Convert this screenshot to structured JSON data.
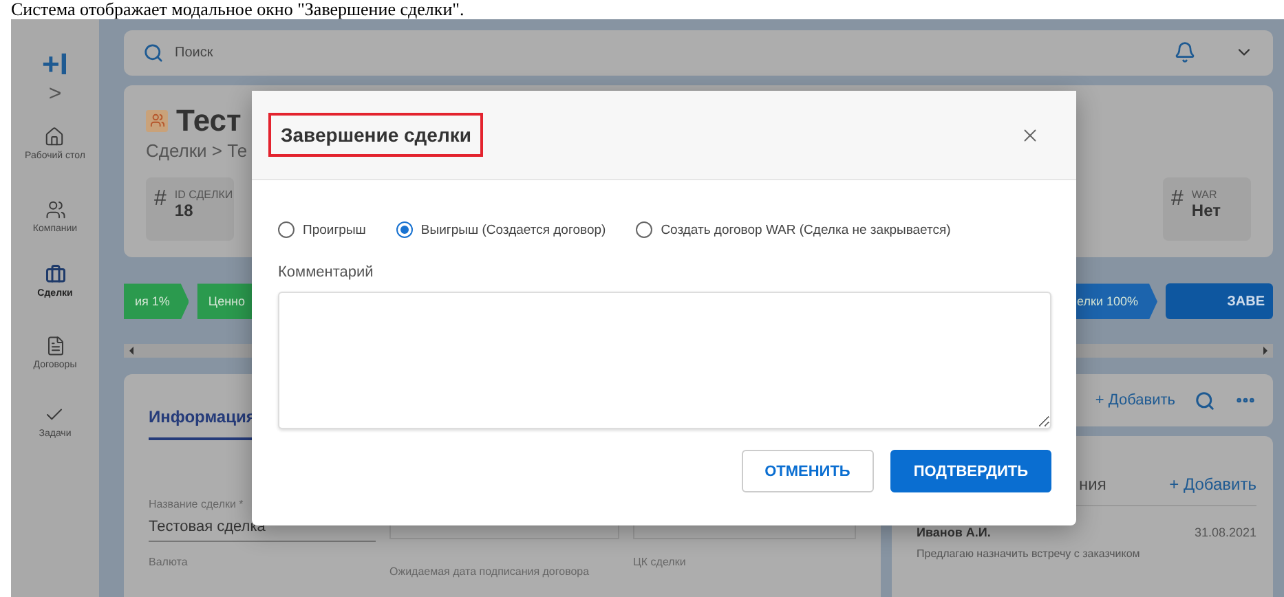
{
  "caption": "Система отображает модальное окно \"Завершение сделки\".",
  "sidebar": {
    "logo": "+I",
    "expand": ">",
    "items": [
      {
        "kind": "home",
        "label": "Рабочий стол",
        "selected": false
      },
      {
        "kind": "people",
        "label": "Компании",
        "selected": false
      },
      {
        "kind": "briefcase",
        "label": "Сделки",
        "selected": true
      },
      {
        "kind": "document",
        "label": "Договоры",
        "selected": false
      },
      {
        "kind": "check",
        "label": "Задачи",
        "selected": false
      }
    ]
  },
  "topbar": {
    "search_placeholder": "Поиск"
  },
  "deal": {
    "title": "Тест",
    "breadcrumb": "Сделки > Те",
    "stats": [
      {
        "icon": "#",
        "label": "ID СДЕЛКИ",
        "value": "18"
      },
      {
        "icon": "#",
        "label": "WAR",
        "value": "Нет"
      }
    ]
  },
  "stages": {
    "left": [
      {
        "label": "ия 1%",
        "kind": "done"
      },
      {
        "label": "Ценно",
        "kind": "done"
      }
    ],
    "right": [
      {
        "label": "елки 100%",
        "kind": "current"
      }
    ],
    "finish_button": "ЗАВЕ"
  },
  "info_panel": {
    "tab": "Информация",
    "name_label": "Название сделки *",
    "name_value": "Тестовая сделка",
    "currency_label": "Валюта",
    "date_label": "Ожидаемая дата подписания договора",
    "ck_label": "ЦК сделки"
  },
  "actions": {
    "add": "+ Добавить"
  },
  "comments": {
    "heading": "ния",
    "add": "+ Добавить",
    "items": [
      {
        "author": "Иванов А.И.",
        "date": "31.08.2021",
        "text": "Предлагаю назначить встречу с заказчиком"
      }
    ]
  },
  "modal": {
    "title": "Завершение сделки",
    "options": [
      {
        "label": "Проигрыш",
        "selected": false
      },
      {
        "label": "Выигрыш (Создается договор)",
        "selected": true
      },
      {
        "label": "Создать договор WAR (Сделка не закрывается)",
        "selected": false
      }
    ],
    "comment_label": "Комментарий",
    "buttons": [
      {
        "label": "ОТМЕНИТЬ",
        "kind": "secondary"
      },
      {
        "label": "ПОДТВЕРДИТЬ",
        "kind": "primary"
      }
    ]
  }
}
